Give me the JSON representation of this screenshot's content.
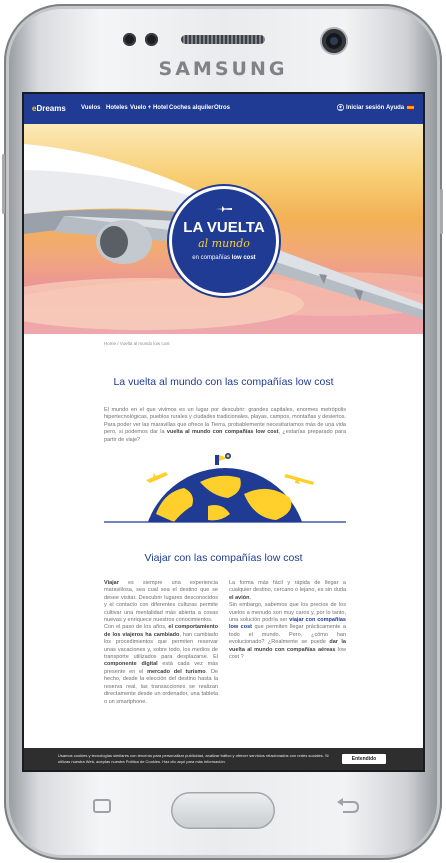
{
  "device": {
    "brand": "SAMSUNG"
  },
  "nav": {
    "logo_prefix": "e",
    "logo_name": "Dreams",
    "items": [
      "Vuelos",
      "Hoteles",
      "Vuelo + Hotel",
      "Coches alquiler",
      "Otros"
    ],
    "login": "Iniciar sesión",
    "help": "Ayuda"
  },
  "hero": {
    "badge_line1": "LA VUELTA",
    "badge_line2": "al mundo",
    "badge_line3_prefix": "en compañías",
    "badge_line3_bold": "low cost"
  },
  "caption": "Home / Vuelta al mundo low cost",
  "section1": {
    "title": "La vuelta al mundo con las compañías low cost",
    "intro_text": "El mundo en el que vivimos es un lugar por descubrir: grandes capitales, enormes metrópolis hipertecnológicas, pueblos rurales y ciudades tradicionales, playas, campos, montañas y desiertos. Para poder ver las maravillas que ofrece la Tierra, probablemente necesitaríamos más de una vida pero, si podemos dar la ",
    "intro_bold": "vuelta al mundo con compañías low cost",
    "intro_end": ", ¿estarías preparado para partir de viaje?"
  },
  "section2": {
    "title": "Viajar con las compañías low cost",
    "left_bold1": "Viajar",
    "left_text1": " es siempre una experiencia maravillosa, sea cual sea el destino que se desee visitar. Descubrir lugares desconocidos y el contacto con diferentes culturas permite cultivar una mentalidad más abierta a cosas nuevas y enriquece nuestros conocimientos.",
    "left_text2": "Con el paso de los años, ",
    "left_bold2": "el comportamiento de los viajeros ha cambiado",
    "left_text3": ", han cambiado los procedimientos que permiten reservar unas vacaciones y, sobre todo, los medios de transporte utilizados para desplazarse. El ",
    "left_bold3": "componente digital",
    "left_text4": " está cada vez más presente en el ",
    "left_bold4": "mercado del turismo",
    "left_text5": ". De hecho, desde la elección del destino hasta la reserva real, las transacciones se realizan directamente desde un ordenador, una tableta o un smartphone.",
    "right_text1": "La forma más fácil y rápida de llegar a cualquier destino, cercano o lejano, es sin duda ",
    "right_bold1": "el avión",
    "right_text2": "Sin embargo, sabemos que los precios de los vuelos a menudo son muy caros y, por lo tanto, una solución podría ser ",
    "right_link": "viajar con compañías low cost",
    "right_text3": " que permiten llegar prácticamente a todo el mundo. Pero, ¿cómo han evolucionado? ¿Realmente se puede ",
    "right_bold2": "dar la vuelta al mundo con compañías aéreas",
    "right_text4": " low cost ?"
  },
  "cookie": {
    "text": "Usamos cookies y tecnologías similares con terceros para personalizar publicidad, analizar tráfico y ofrecer servicios relacionados con redes sociales. Si utilizas nuestra Web, aceptas nuestra Política de Cookies. Haz clic aquí para más información.",
    "button": "Entendido"
  },
  "colors": {
    "brand_blue": "#1f3b93",
    "accent_yellow": "#ffd02b",
    "hero_sky": "#f3b155"
  }
}
